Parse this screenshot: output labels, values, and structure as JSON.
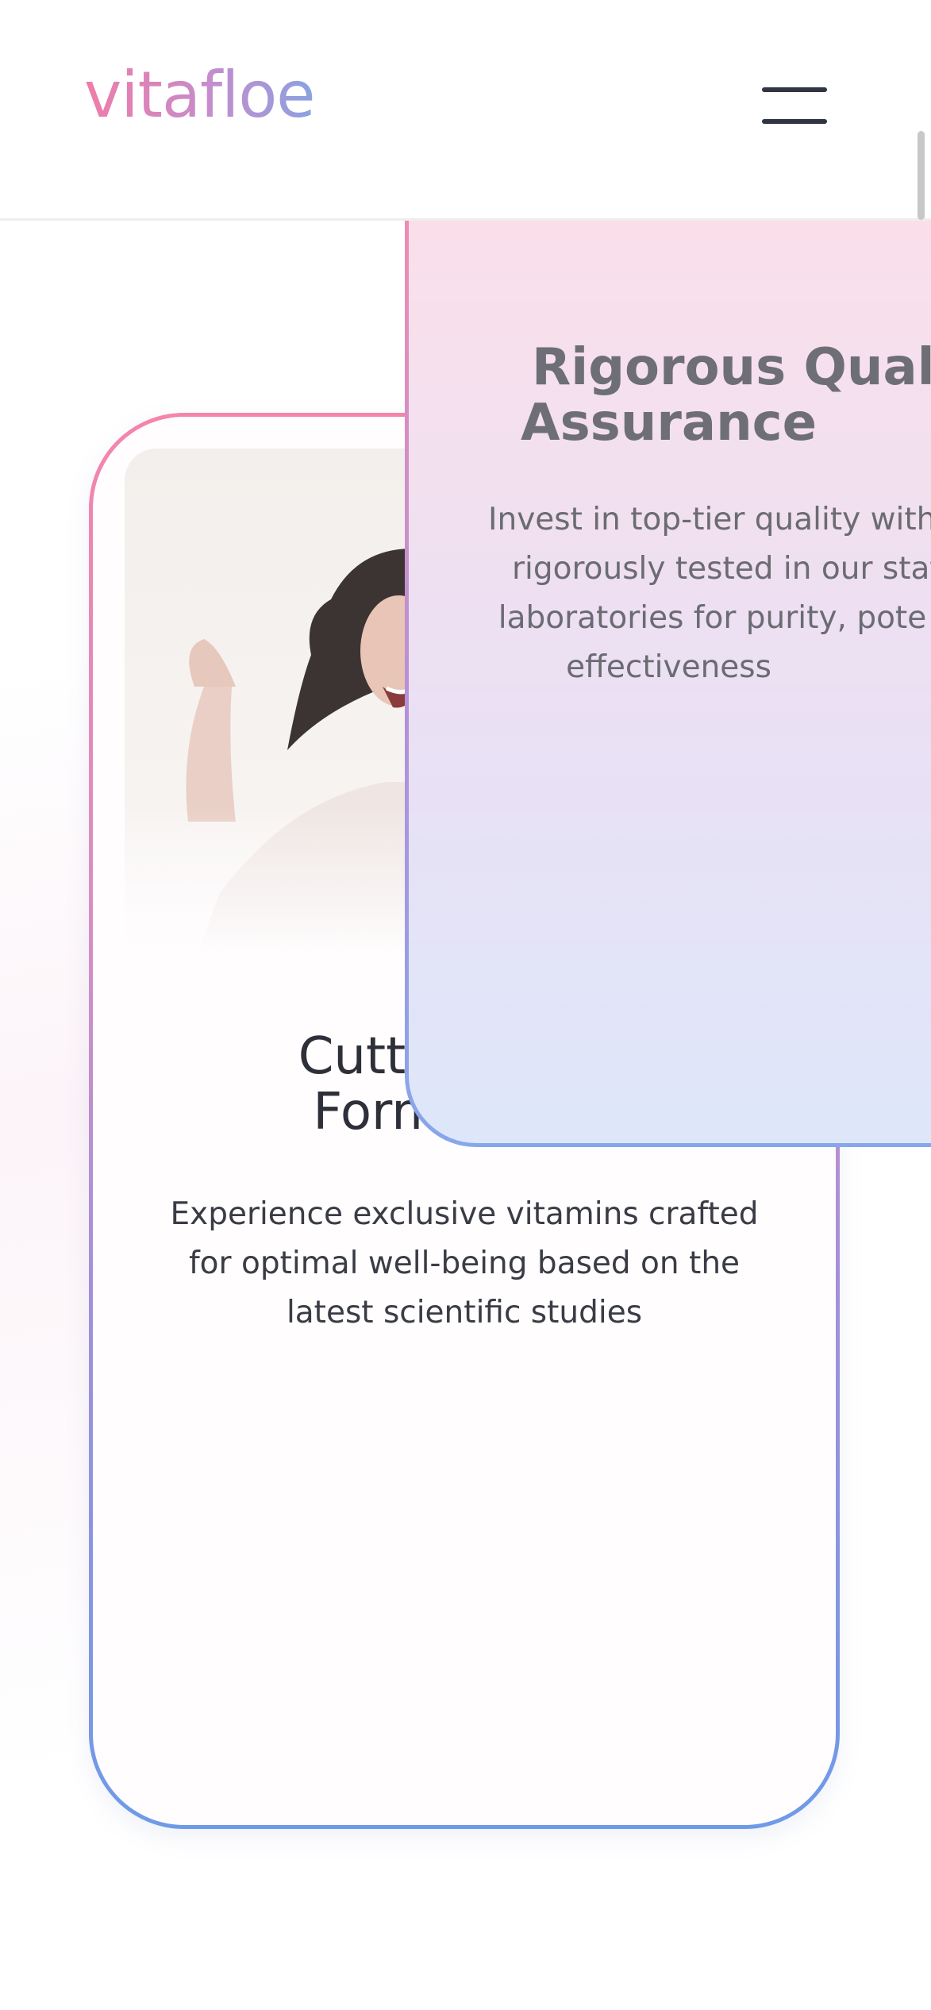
{
  "header": {
    "logo": "vitafloe",
    "menu_icon": "hamburger-menu-icon"
  },
  "cards": [
    {
      "title": "Cutting-Edge Formulation",
      "title_lines": [
        "Cutting-Edge",
        "Formulation"
      ],
      "description": "Experience exclusive vitamins crafted for optimal well-being based on the latest scientific studies",
      "image": "laughing-woman-photo"
    },
    {
      "title_lines": [
        "Rigorous Qual",
        "Assurance"
      ],
      "description_lines": [
        "Invest in top-tier quality with",
        "rigorously tested in our state-",
        "laboratories for purity, pote",
        "effectiveness"
      ]
    }
  ],
  "colors": {
    "logo_gradient": [
      "#f07ca8",
      "#c48dcc",
      "#8aa2e2"
    ],
    "card_border_gradient": [
      "#f485ab",
      "#a690d8",
      "#6e9ae8"
    ],
    "text_dark": "#2e3039",
    "text_muted": "#6e6e76"
  }
}
